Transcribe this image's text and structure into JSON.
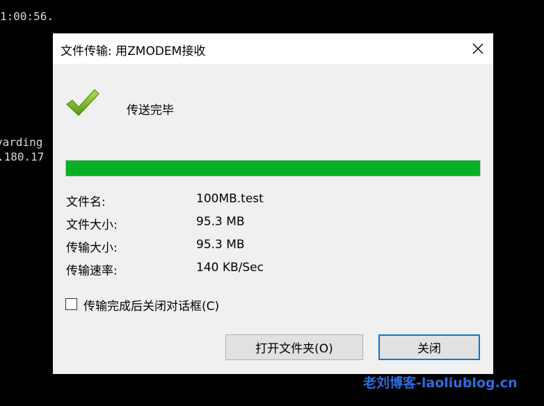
{
  "terminal": {
    "line1": "1:00:56.",
    "line2": "varding",
    "line3": ".180.17"
  },
  "dialog": {
    "title": "文件传输: 用ZMODEM接收",
    "status": "传送完毕",
    "progress_percent": 100,
    "progress_color": "#06b025",
    "info": [
      {
        "label": "文件名:",
        "value": "100MB.test"
      },
      {
        "label": "文件大小:",
        "value": "95.3 MB"
      },
      {
        "label": "传输大小:",
        "value": "95.3 MB"
      },
      {
        "label": "传输速率:",
        "value": "140 KB/Sec"
      }
    ],
    "auto_close_label": "传输完成后关闭对话框(C)",
    "auto_close_checked": false,
    "open_folder_label": "打开文件夹(O)",
    "close_label": "关闭"
  },
  "watermark": "老刘博客-laoliublog.cn",
  "icons": {
    "status": "green-checkmark-icon",
    "close": "close-icon"
  }
}
